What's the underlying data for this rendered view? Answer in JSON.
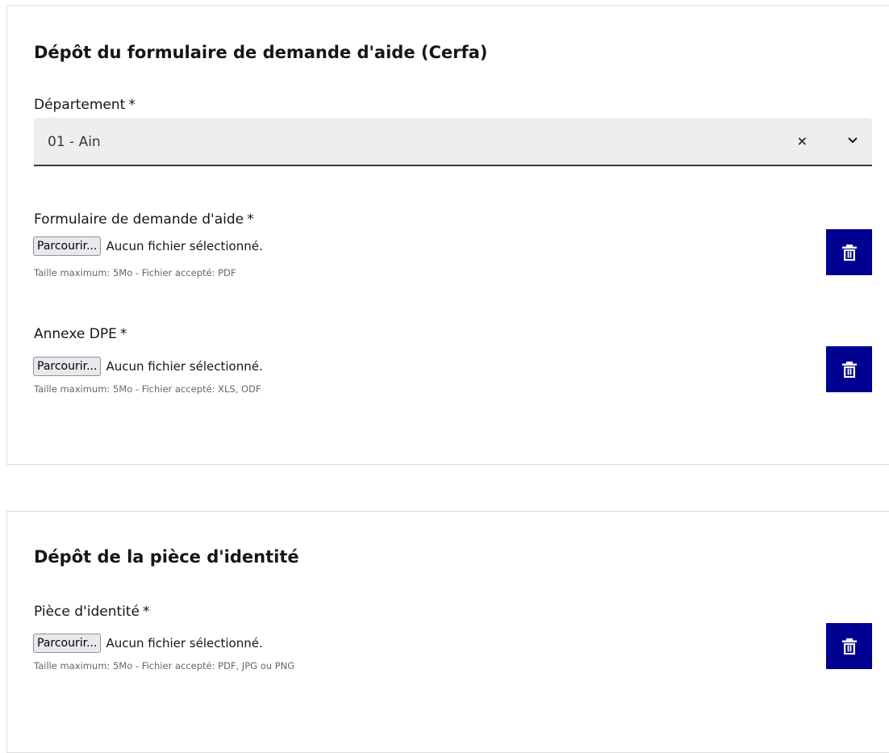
{
  "sections": [
    {
      "title": "Dépôt du formulaire de demande d'aide (Cerfa)",
      "select": {
        "label": "Département",
        "required_mark": "*",
        "value": "01 - Ain",
        "clear_glyph": "×",
        "icon": "chevron-down-icon"
      },
      "uploads": [
        {
          "label": "Formulaire de demande d'aide",
          "required_mark": "*",
          "button_label": "Parcourir...",
          "status": "Aucun fichier sélectionné.",
          "hint": "Taille maximum: 5Mo - Fichier accepté: PDF",
          "delete_icon": "trash-icon"
        },
        {
          "label": "Annexe DPE",
          "required_mark": "*",
          "button_label": "Parcourir...",
          "status": "Aucun fichier sélectionné.",
          "hint": "Taille maximum: 5Mo - Fichier accepté: XLS, ODF",
          "delete_icon": "trash-icon"
        }
      ]
    },
    {
      "title": "Dépôt de la pièce d'identité",
      "uploads": [
        {
          "label": "Pièce d'identité",
          "required_mark": "*",
          "button_label": "Parcourir...",
          "status": "Aucun fichier sélectionné.",
          "hint": "Taille maximum: 5Mo - Fichier accepté: PDF, JPG ou PNG",
          "delete_icon": "trash-icon"
        }
      ]
    }
  ],
  "colors": {
    "primary_blue": "#000091",
    "select_background": "#eeeeee",
    "border": "#dddddd"
  }
}
